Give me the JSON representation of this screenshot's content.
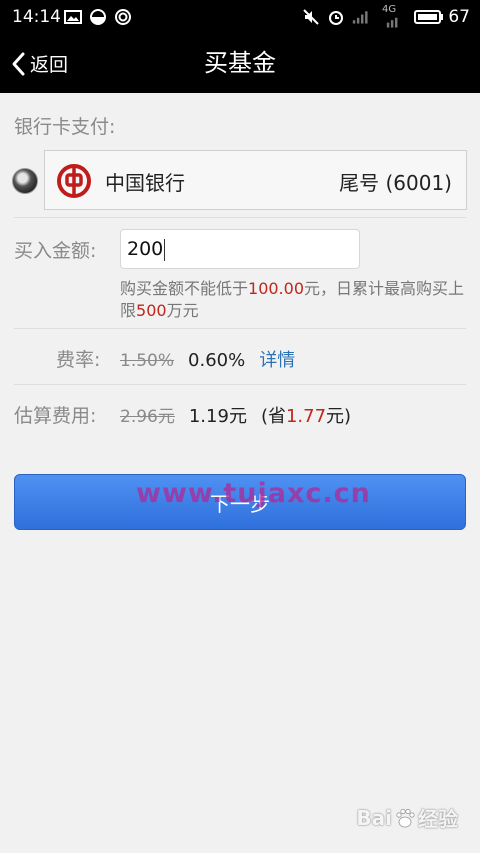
{
  "status_bar": {
    "time": "14:14",
    "battery": "67",
    "network": "4G"
  },
  "nav": {
    "back_label": "返回",
    "title": "买基金"
  },
  "payment": {
    "section_label": "银行卡支付:",
    "bank_name": "中国银行",
    "card_tail": "尾号 (6001)"
  },
  "amount": {
    "label": "买入金额:",
    "value": "200",
    "hint_part1": "购买金额不能低于",
    "hint_min": "100.00",
    "hint_part2": "元，日累计最高购买上限",
    "hint_max": "500",
    "hint_part3": "万元"
  },
  "rate": {
    "label": "费率:",
    "old": "1.50%",
    "new": "0.60%",
    "detail_label": "详情"
  },
  "fee": {
    "label": "估算费用:",
    "old": "2.96元",
    "new": "1.19元",
    "save_prefix": "(省",
    "save_amount": "1.77",
    "save_suffix": "元)"
  },
  "next_button": "下一步",
  "watermark": "www.tujaxc.cn",
  "baidu_watermark": {
    "left": "Bai",
    "right": "经验"
  },
  "colors": {
    "accent_red": "#c0261c",
    "link_blue": "#2c73b6",
    "button_blue": "#3a7ee6",
    "bank_red": "#c01c1c"
  }
}
